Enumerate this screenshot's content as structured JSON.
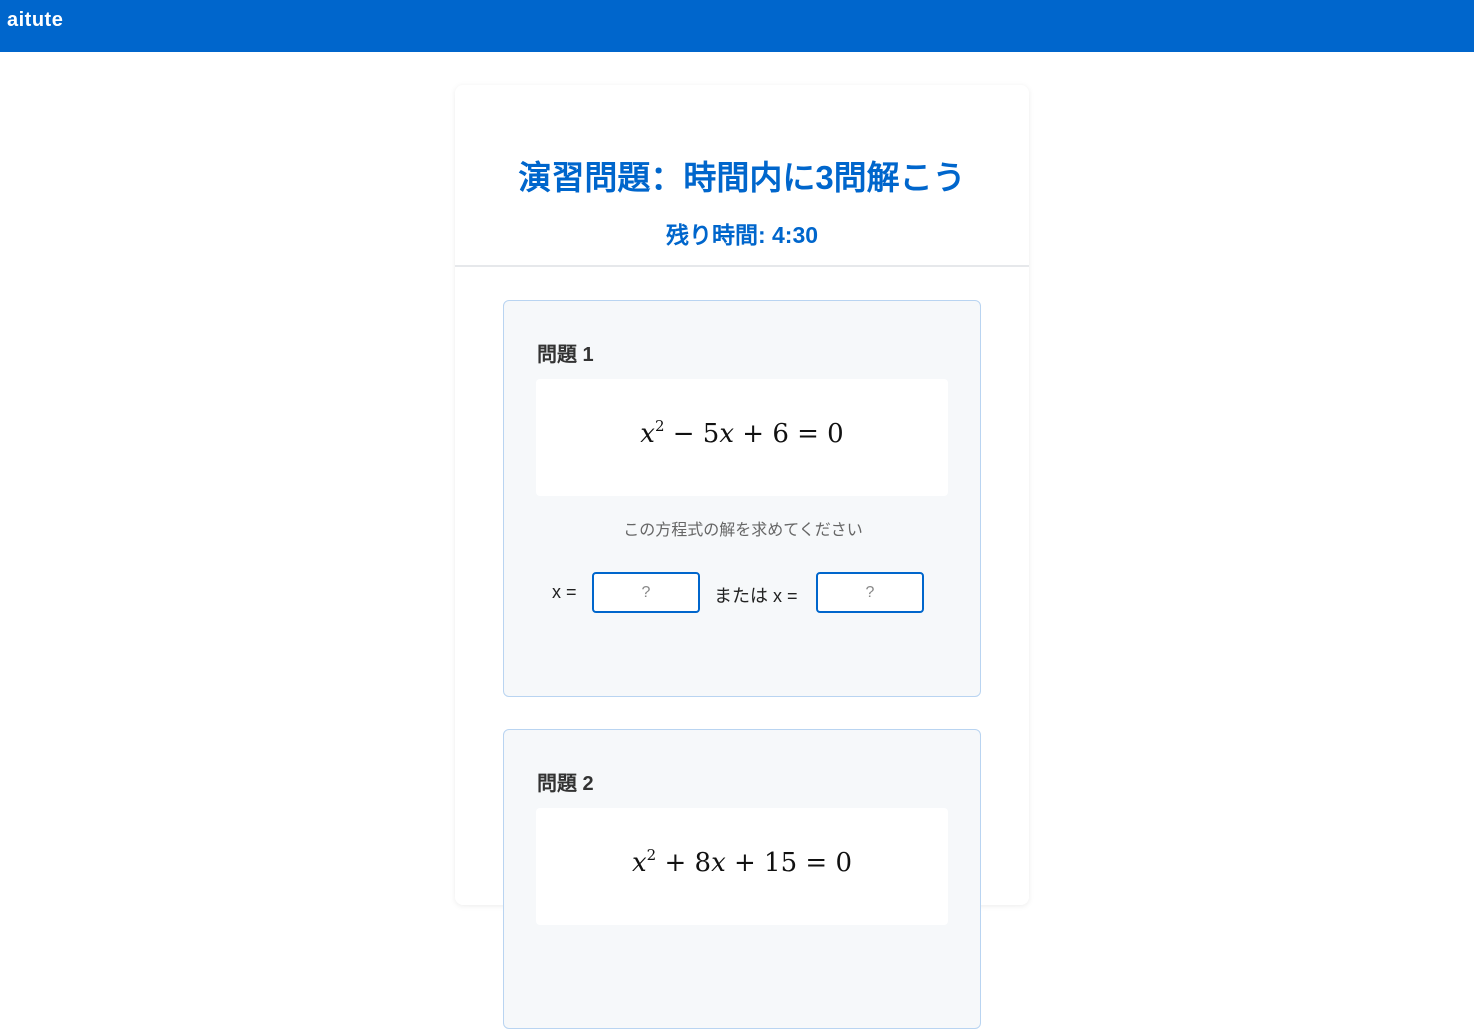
{
  "app": {
    "brand": "aitute"
  },
  "header": {
    "title": "演習問題：時間内に3問解こう",
    "timer": "残り時間: 4:30"
  },
  "colors": {
    "accent": "#0066cc",
    "panel_bg": "#f6f8fa",
    "panel_border": "#b9d4f1"
  },
  "problems": [
    {
      "label": "問題 1",
      "equation": {
        "a": "x",
        "exp": "2",
        "rest": " − 5",
        "b": "x",
        "tail": " + 6 = 0"
      },
      "instruction": "この方程式の解を求めてください",
      "answer_label_1": "x =",
      "answer_label_2": "または x =",
      "placeholder": "?"
    },
    {
      "label": "問題 2",
      "equation": {
        "a": "x",
        "exp": "2",
        "rest": " + 8",
        "b": "x",
        "tail": " + 15 = 0"
      }
    }
  ]
}
